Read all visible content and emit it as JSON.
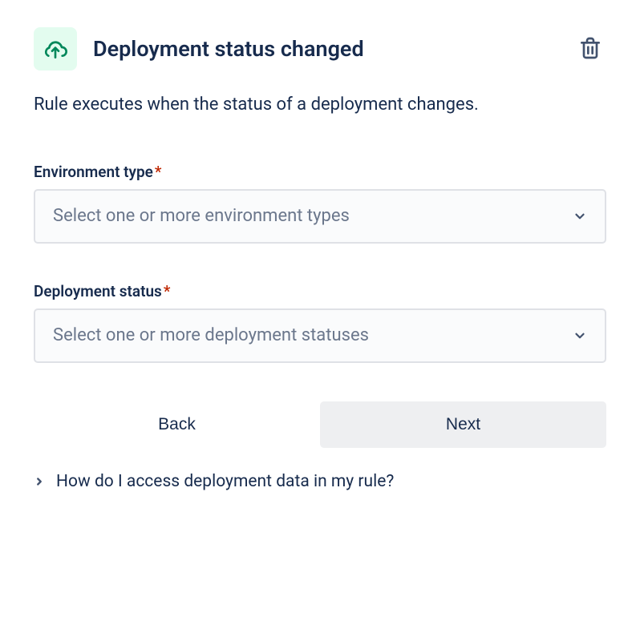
{
  "header": {
    "title": "Deployment status changed"
  },
  "description": "Rule executes when the status of a deployment changes.",
  "fields": {
    "environment": {
      "label": "Environment type",
      "placeholder": "Select one or more environment types"
    },
    "deploymentStatus": {
      "label": "Deployment status",
      "placeholder": "Select one or more deployment statuses"
    }
  },
  "buttons": {
    "back": "Back",
    "next": "Next"
  },
  "help": {
    "text": "How do I access deployment data in my rule?"
  }
}
